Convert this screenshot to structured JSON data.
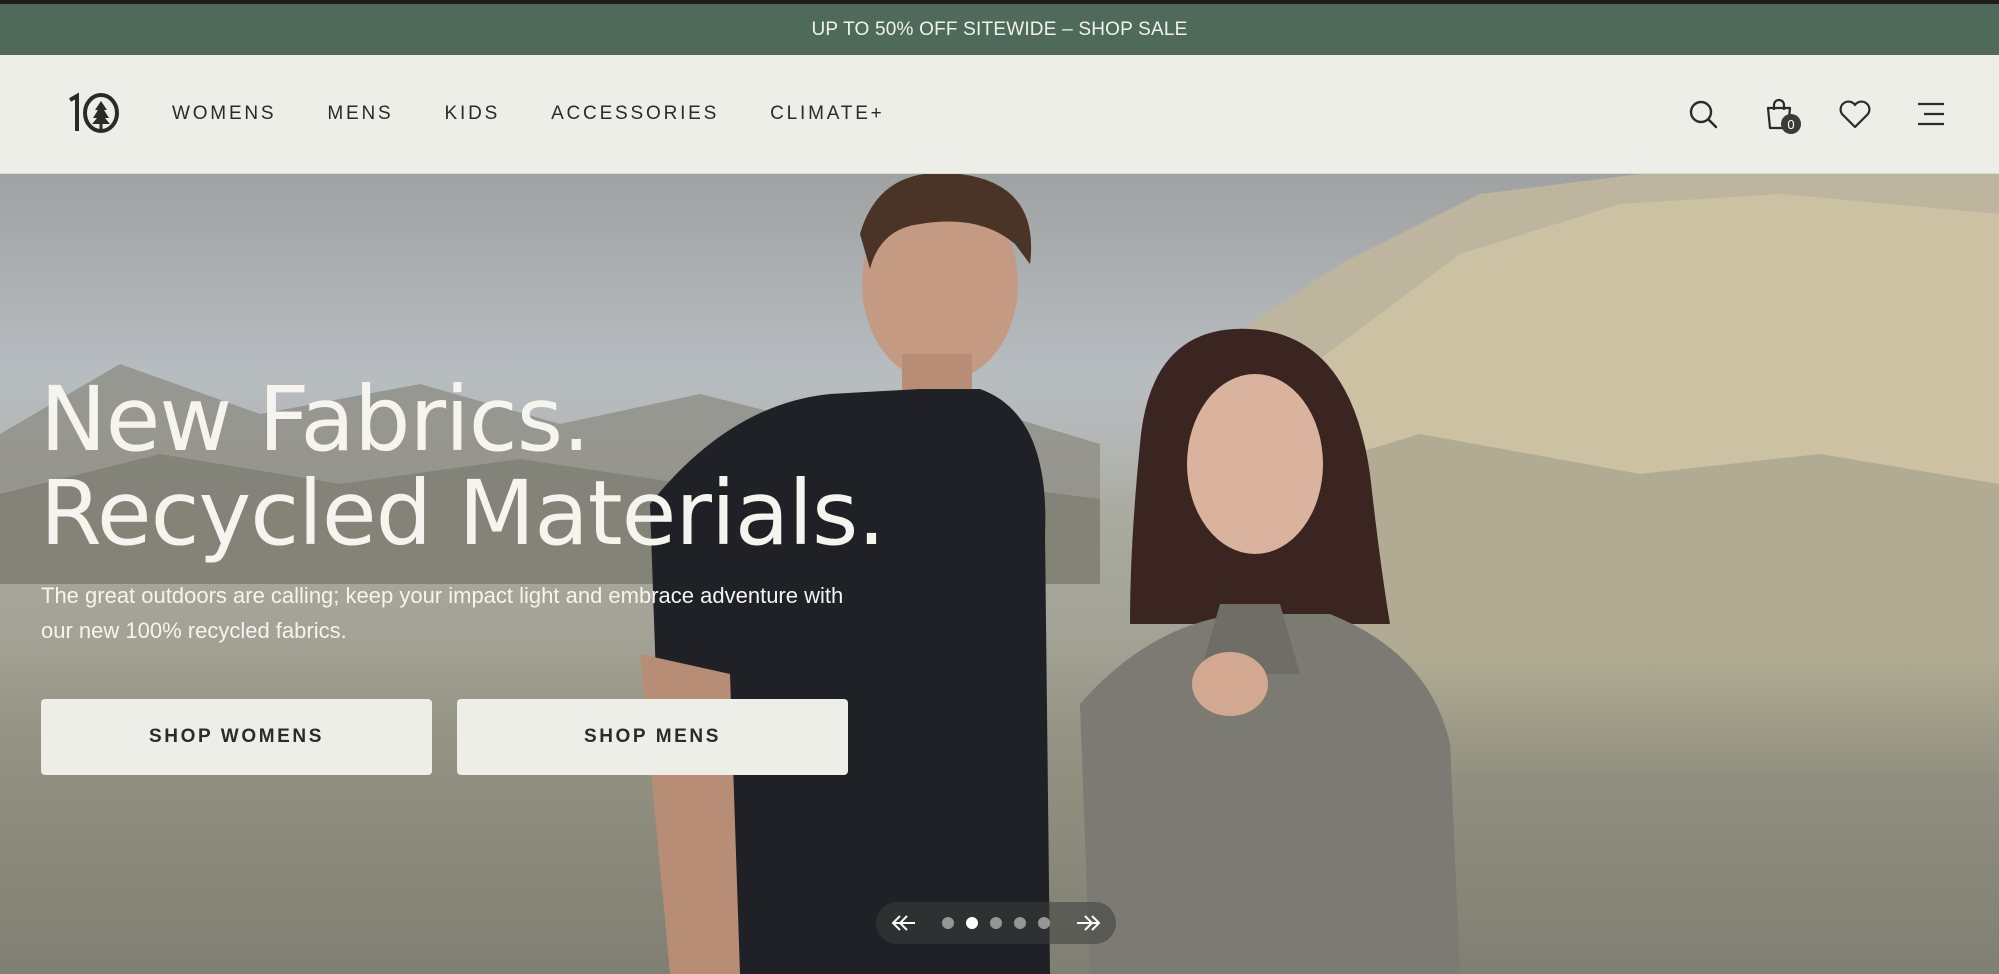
{
  "promo": {
    "text": "UP TO 50% OFF SITEWIDE – SHOP SALE"
  },
  "header": {
    "logo_text": "10",
    "nav": [
      "WOMENS",
      "MENS",
      "KIDS",
      "ACCESSORIES",
      "CLIMATE+"
    ],
    "bag_count": "0",
    "icons": [
      "search-icon",
      "bag-icon",
      "heart-icon",
      "menu-icon"
    ]
  },
  "hero": {
    "headline_line1": "New Fabrics.",
    "headline_line2": "Recycled Materials.",
    "subtext": "The great outdoors are calling; keep your impact light and embrace adventure with our new 100% recycled fabrics.",
    "cta_women": "SHOP WOMENS",
    "cta_men": "SHOP MENS"
  },
  "carousel": {
    "slide_count": 5,
    "active_slide": 2
  },
  "colors": {
    "promo_bg": "#4f6a5a",
    "header_bg": "#edeee8",
    "button_bg": "#edeee8",
    "text_dark": "#2a2a2a"
  }
}
